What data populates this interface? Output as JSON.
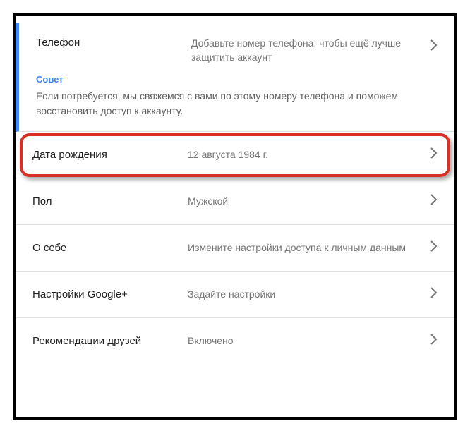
{
  "phone": {
    "label": "Телефон",
    "value": "Добавьте номер телефона, чтобы ещё лучше защитить аккаунт",
    "hint_label": "Совет",
    "hint_text": "Если потребуется, мы свяжемся с вами по этому номеру телефона и поможем восстановить доступ к аккаунту."
  },
  "rows": {
    "birthday": {
      "label": "Дата рождения",
      "value": "12 августа 1984 г."
    },
    "gender": {
      "label": "Пол",
      "value": "Мужской"
    },
    "about": {
      "label": "О себе",
      "value": "Измените настройки доступа к личным данным"
    },
    "googleplus": {
      "label": "Настройки Google+",
      "value": "Задайте настройки"
    },
    "recommendations": {
      "label": "Рекомендации друзей",
      "value": "Включено"
    }
  }
}
